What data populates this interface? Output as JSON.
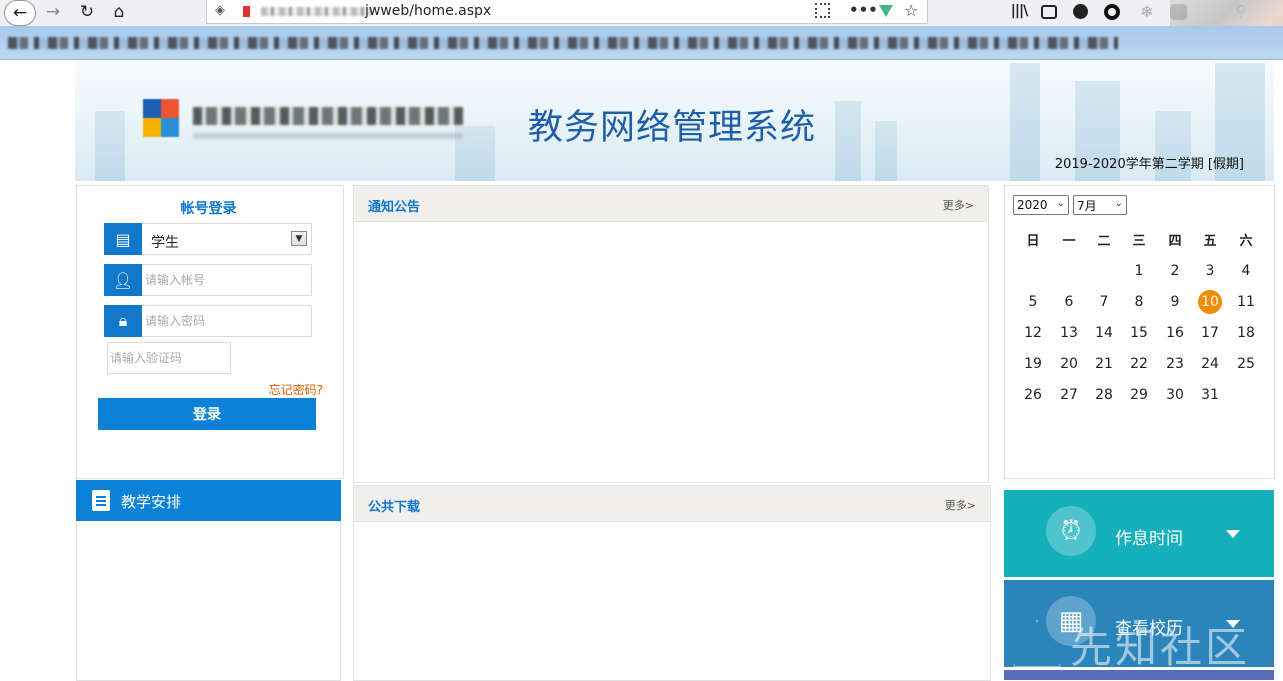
{
  "browser": {
    "url_visible": "jwweb/home.aspx"
  },
  "banner": {
    "system_title": "教务网络管理系统",
    "term": "2019-2020学年第二学期 [假期]"
  },
  "login": {
    "title": "帐号登录",
    "role_value": "学生",
    "account_placeholder": "请输入帐号",
    "password_placeholder": "请输入密码",
    "captcha_placeholder": "请输入验证码",
    "forgot_label": "忘记密码?",
    "submit_label": "登录"
  },
  "notice": {
    "title": "通知公告",
    "more_label": "更多>"
  },
  "downloads": {
    "title": "公共下载",
    "more_label": "更多>"
  },
  "teaching": {
    "label": "教学安排"
  },
  "calendar": {
    "year": "2020",
    "month": "7月",
    "weekdays": [
      "日",
      "一",
      "二",
      "三",
      "四",
      "五",
      "六"
    ],
    "weeks": [
      [
        "",
        "",
        "",
        "1",
        "2",
        "3",
        "4"
      ],
      [
        "5",
        "6",
        "7",
        "8",
        "9",
        "10",
        "11"
      ],
      [
        "12",
        "13",
        "14",
        "15",
        "16",
        "17",
        "18"
      ],
      [
        "19",
        "20",
        "21",
        "22",
        "23",
        "24",
        "25"
      ],
      [
        "26",
        "27",
        "28",
        "29",
        "30",
        "31",
        ""
      ]
    ],
    "today": "10",
    "today_color": "#f08c00"
  },
  "tiles": {
    "rest_label": "作息时间",
    "rest_icon": "alarm-clock-icon",
    "calendar_label": "查看校历",
    "calendar_icon": "calendar-icon"
  },
  "watermark": {
    "text": "先知社区"
  },
  "colors": {
    "primary": "#0b82d8",
    "title": "#1f5fa8",
    "tile_rest": "#16b0bb",
    "tile_calendar": "#2b85bb"
  }
}
